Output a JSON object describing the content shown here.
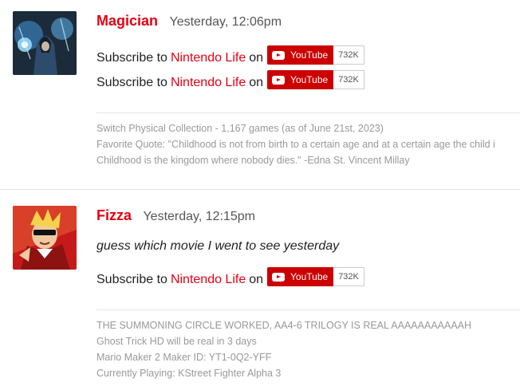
{
  "posts": [
    {
      "author": "Magician",
      "time": "Yesterday, 12:06pm",
      "subscribe_lines": [
        {
          "prefix": "Subscribe to",
          "link": "Nintendo Life",
          "suffix": "on",
          "button": "YouTube",
          "count": "732K"
        },
        {
          "prefix": "Subscribe to",
          "link": "Nintendo Life",
          "suffix": "on",
          "button": "YouTube",
          "count": "732K"
        }
      ],
      "signature": [
        "Switch Physical Collection - 1,167 games (as of June 21st, 2023)",
        "Favorite Quote: \"Childhood is not from birth to a certain age and at a certain age the child i",
        "Childhood is the kingdom where nobody dies.\" -Edna St. Vincent Millay"
      ]
    },
    {
      "author": "Fizza",
      "time": "Yesterday, 12:15pm",
      "message": "guess which movie I went to see yesterday",
      "subscribe_lines": [
        {
          "prefix": "Subscribe to",
          "link": "Nintendo Life",
          "suffix": "on",
          "button": "YouTube",
          "count": "732K"
        }
      ],
      "signature": [
        "THE SUMMONING CIRCLE WORKED, AA4-6 TRILOGY IS REAL AAAAAAAAAAAH",
        "Ghost Trick HD will be real in 3 days",
        "Mario Maker 2 Maker ID: YT1-0Q2-YFF",
        "Currently Playing: KStreet Fighter Alpha 3"
      ]
    }
  ],
  "colors": {
    "accent": "#e60012",
    "youtube": "#cc0000"
  }
}
